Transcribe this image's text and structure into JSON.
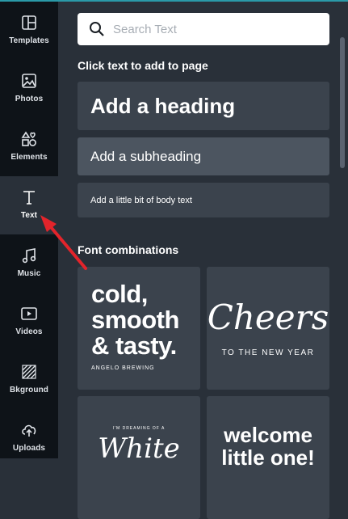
{
  "sidebar": {
    "items": [
      {
        "label": "Templates",
        "icon": "templates-icon"
      },
      {
        "label": "Photos",
        "icon": "photos-icon"
      },
      {
        "label": "Elements",
        "icon": "elements-icon"
      },
      {
        "label": "Text",
        "icon": "text-icon",
        "active": true
      },
      {
        "label": "Music",
        "icon": "music-icon"
      },
      {
        "label": "Videos",
        "icon": "videos-icon"
      },
      {
        "label": "Bkground",
        "icon": "background-icon"
      },
      {
        "label": "Uploads",
        "icon": "uploads-icon"
      }
    ]
  },
  "search": {
    "placeholder": "Search Text"
  },
  "text_section": {
    "title": "Click text to add to page",
    "heading": "Add a heading",
    "subheading": "Add a subheading",
    "body": "Add a little bit of body text"
  },
  "fonts_section": {
    "title": "Font combinations",
    "cards": [
      {
        "main": "cold, smooth & tasty.",
        "line1": "cold,",
        "line2": "smooth",
        "line3": "& tasty.",
        "sub": "ANGELO BREWING"
      },
      {
        "main": "Cheers",
        "sub": "TO THE NEW YEAR"
      },
      {
        "top": "I'M DREAMING OF A",
        "main": "White"
      },
      {
        "line1": "welcome",
        "line2": "little one!"
      }
    ]
  },
  "colors": {
    "panel": "#293039",
    "sidebar": "#0e1318",
    "button": "#3b434d",
    "arrow": "#e3242b"
  }
}
